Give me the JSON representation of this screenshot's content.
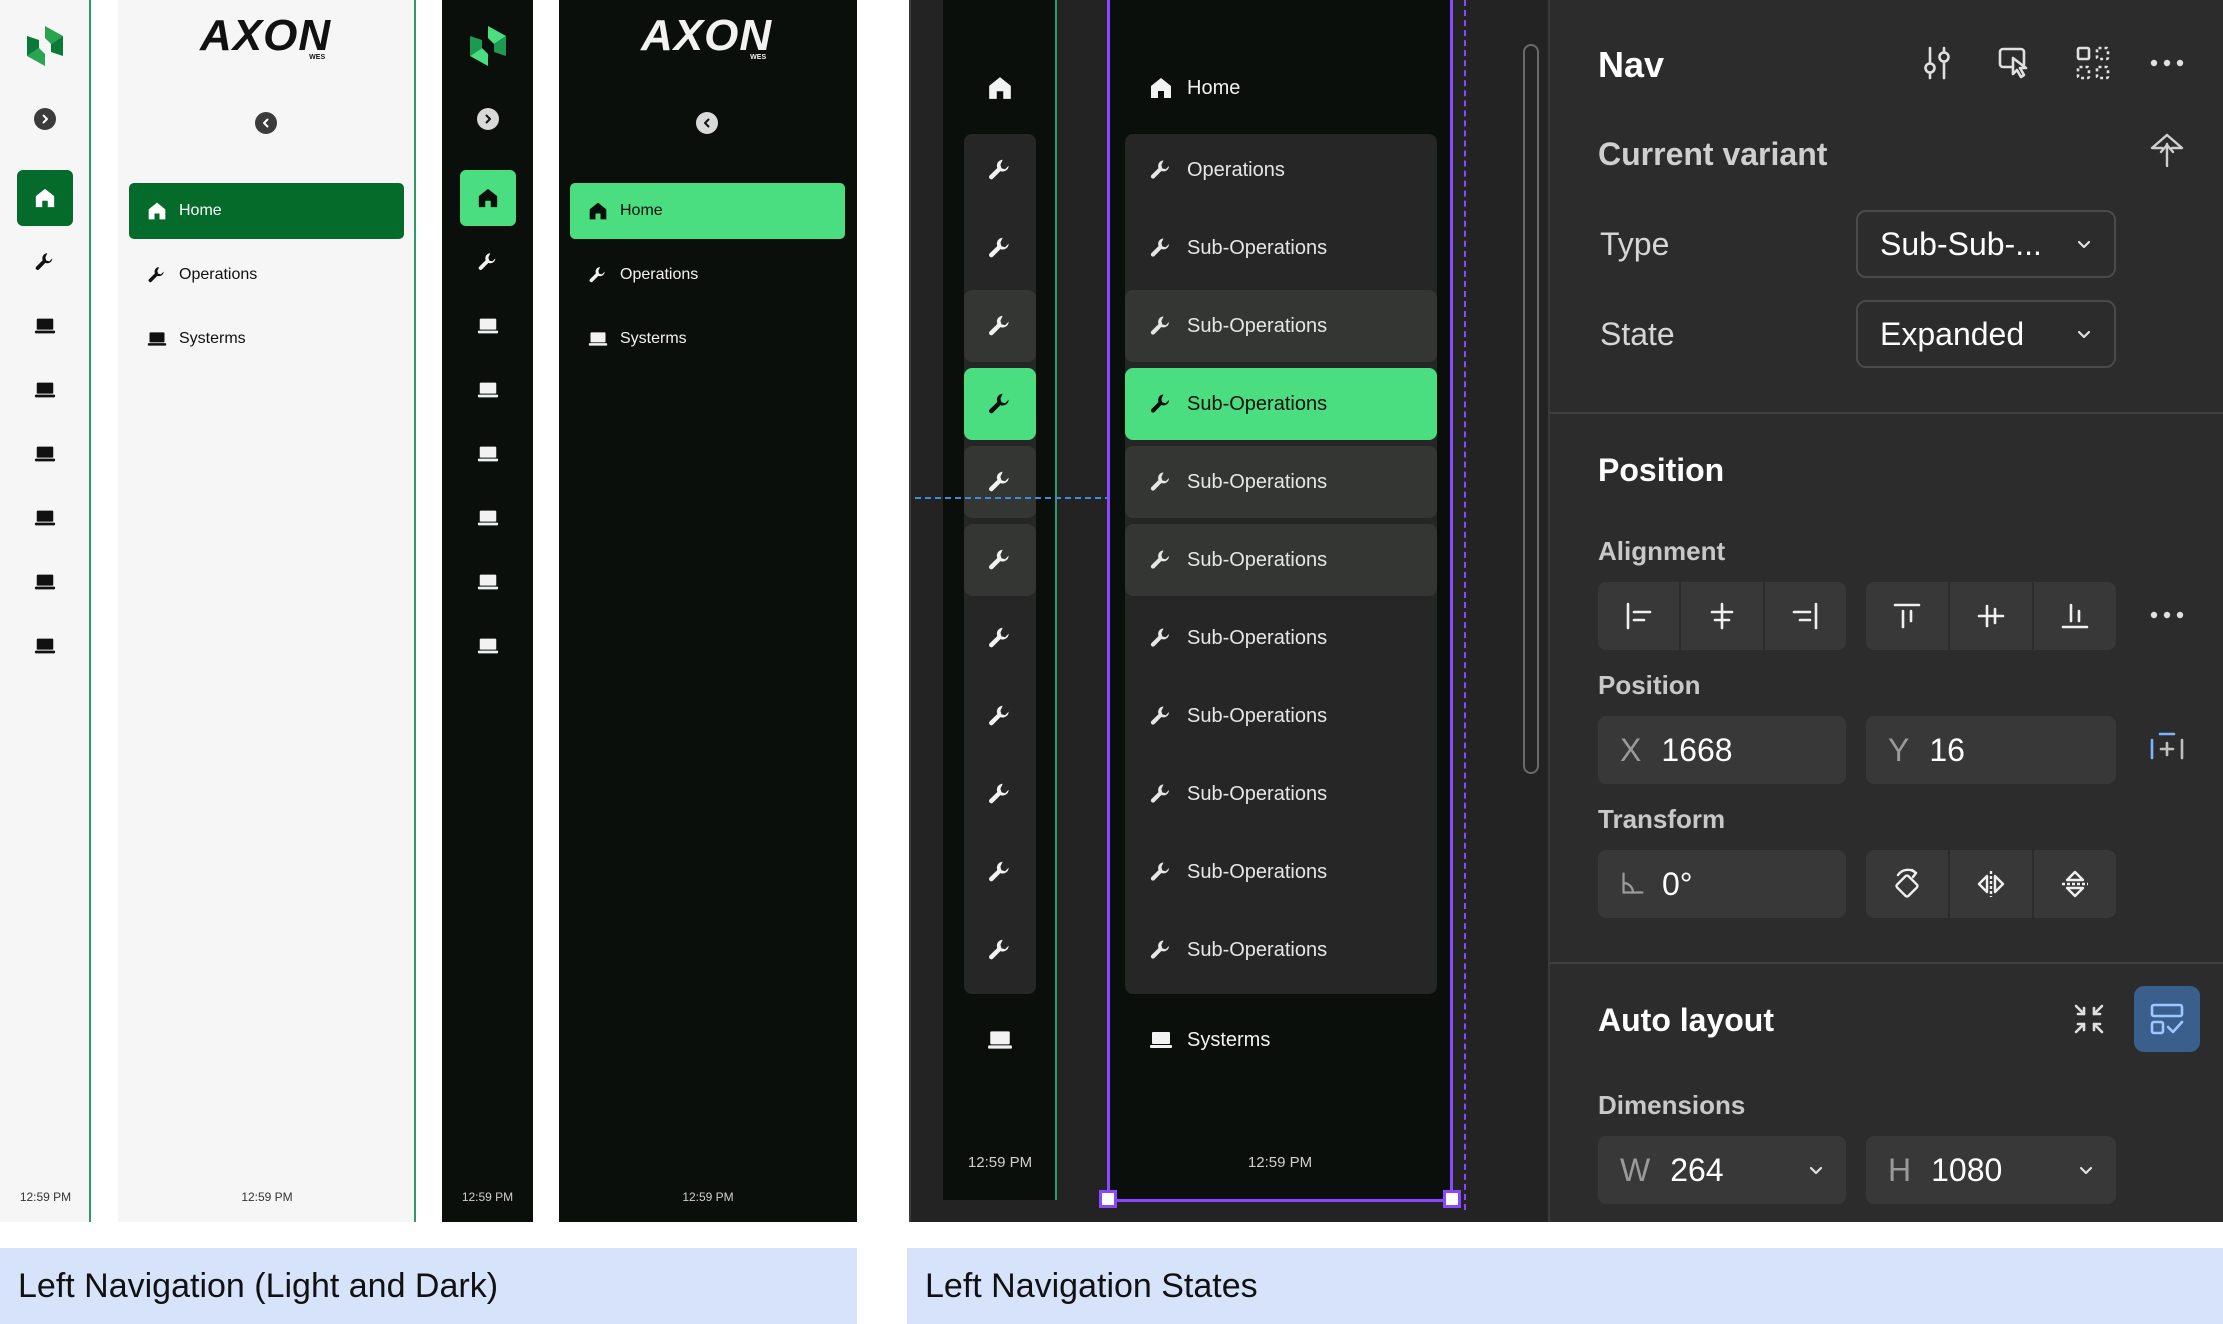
{
  "brand": {
    "name": "AXON",
    "sub": "WES"
  },
  "nav": {
    "home_label": "Home",
    "operations_label": "Operations",
    "systems_label": "Systerms",
    "time": "12:59 PM"
  },
  "states": {
    "home_label": "Home",
    "operations_label": "Operations",
    "sub_label": "Sub-Operations",
    "systems_label": "Systerms",
    "time": "12:59 PM"
  },
  "inspector": {
    "title": "Nav",
    "current_variant": "Current variant",
    "type_label": "Type",
    "type_value": "Sub-Sub-...",
    "state_label": "State",
    "state_value": "Expanded",
    "position_title": "Position",
    "alignment_label": "Alignment",
    "position_label": "Position",
    "x_prefix": "X",
    "x_value": "1668",
    "y_prefix": "Y",
    "y_value": "16",
    "transform_label": "Transform",
    "rotation_value": "0°",
    "auto_layout_title": "Auto layout",
    "dimensions_label": "Dimensions",
    "w_prefix": "W",
    "w_value": "264",
    "h_prefix": "H",
    "h_value": "1080"
  },
  "captions": {
    "left": "Left Navigation (Light and Dark)",
    "right": "Left Navigation States"
  },
  "colors": {
    "brand_green_dark": "#046b2b",
    "brand_green_light": "#4ade80",
    "dark_bg": "#0b0f0c",
    "panel_bg": "#2c2c2c",
    "selection_purple": "#8b46ff",
    "caption_bg": "#d6e3fb"
  },
  "icons": [
    "logo-mark-icon",
    "chevron-left-icon",
    "home-icon",
    "wrench-icon",
    "laptop-icon",
    "sliders-icon",
    "hand-pointer-icon",
    "grid-icon",
    "more-icon",
    "detach-icon",
    "chevron-down-icon",
    "align-left-icon",
    "align-center-h-icon",
    "align-right-icon",
    "align-top-icon",
    "align-center-v-icon",
    "align-bottom-icon",
    "add-constraint-icon",
    "angle-icon",
    "rotate-icon",
    "flip-h-icon",
    "flip-v-icon",
    "collapse-icon",
    "auto-layout-icon"
  ]
}
